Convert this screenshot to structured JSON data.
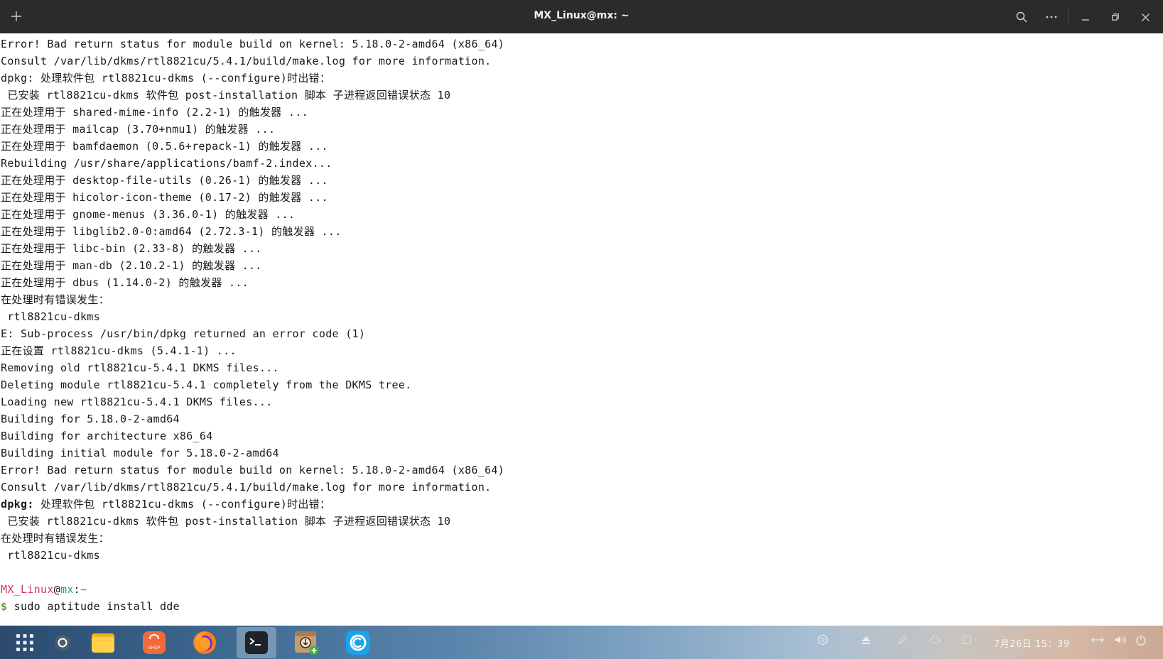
{
  "window": {
    "title": "MX_Linux@mx: ~"
  },
  "terminal": {
    "lines": [
      "Error! Bad return status for module build on kernel: 5.18.0-2-amd64 (x86_64)",
      "Consult /var/lib/dkms/rtl8821cu/5.4.1/build/make.log for more information.",
      "dpkg: 处理软件包 rtl8821cu-dkms (--configure)时出错：",
      " 已安装 rtl8821cu-dkms 软件包 post-installation 脚本 子进程返回错误状态 10",
      "正在处理用于 shared-mime-info (2.2-1) 的触发器 ...",
      "正在处理用于 mailcap (3.70+nmu1) 的触发器 ...",
      "正在处理用于 bamfdaemon (0.5.6+repack-1) 的触发器 ...",
      "Rebuilding /usr/share/applications/bamf-2.index...",
      "正在处理用于 desktop-file-utils (0.26-1) 的触发器 ...",
      "正在处理用于 hicolor-icon-theme (0.17-2) 的触发器 ...",
      "正在处理用于 gnome-menus (3.36.0-1) 的触发器 ...",
      "正在处理用于 libglib2.0-0:amd64 (2.72.3-1) 的触发器 ...",
      "正在处理用于 libc-bin (2.33-8) 的触发器 ...",
      "正在处理用于 man-db (2.10.2-1) 的触发器 ...",
      "正在处理用于 dbus (1.14.0-2) 的触发器 ...",
      "在处理时有错误发生：",
      " rtl8821cu-dkms",
      "E: Sub-process /usr/bin/dpkg returned an error code (1)",
      "正在设置 rtl8821cu-dkms (5.4.1-1) ...",
      "Removing old rtl8821cu-5.4.1 DKMS files...",
      "Deleting module rtl8821cu-5.4.1 completely from the DKMS tree.",
      "Loading new rtl8821cu-5.4.1 DKMS files...",
      "Building for 5.18.0-2-amd64",
      "Building for architecture x86_64",
      "Building initial module for 5.18.0-2-amd64",
      "Error! Bad return status for module build on kernel: 5.18.0-2-amd64 (x86_64)",
      "Consult /var/lib/dkms/rtl8821cu/5.4.1/build/make.log for more information."
    ],
    "bold_line": {
      "prefix": "dpkg:",
      "rest": " 处理软件包 rtl8821cu-dkms (--configure)时出错："
    },
    "tail_lines": [
      " 已安装 rtl8821cu-dkms 软件包 post-installation 脚本 子进程返回错误状态 10",
      "在处理时有错误发生：",
      " rtl8821cu-dkms",
      ""
    ],
    "prompt": {
      "user": "MX_Linux",
      "at": "@",
      "host": "mx",
      "colon": ":",
      "path": "~",
      "dollar": "$",
      "command": " sudo aptitude install dde"
    }
  },
  "taskbar": {
    "clock": "7月26日 15：39",
    "apps": [
      "launcher-icon",
      "multitask-icon",
      "file-manager-icon",
      "app-store-icon",
      "firefox-icon",
      "terminal-icon",
      "package-installer-icon",
      "browser-icon"
    ],
    "shop_label": "SHOP",
    "colors": {
      "accent_pink": "#d6336c",
      "host_teal": "#1e9e8e",
      "dollar_green": "#6a9a1f"
    }
  }
}
